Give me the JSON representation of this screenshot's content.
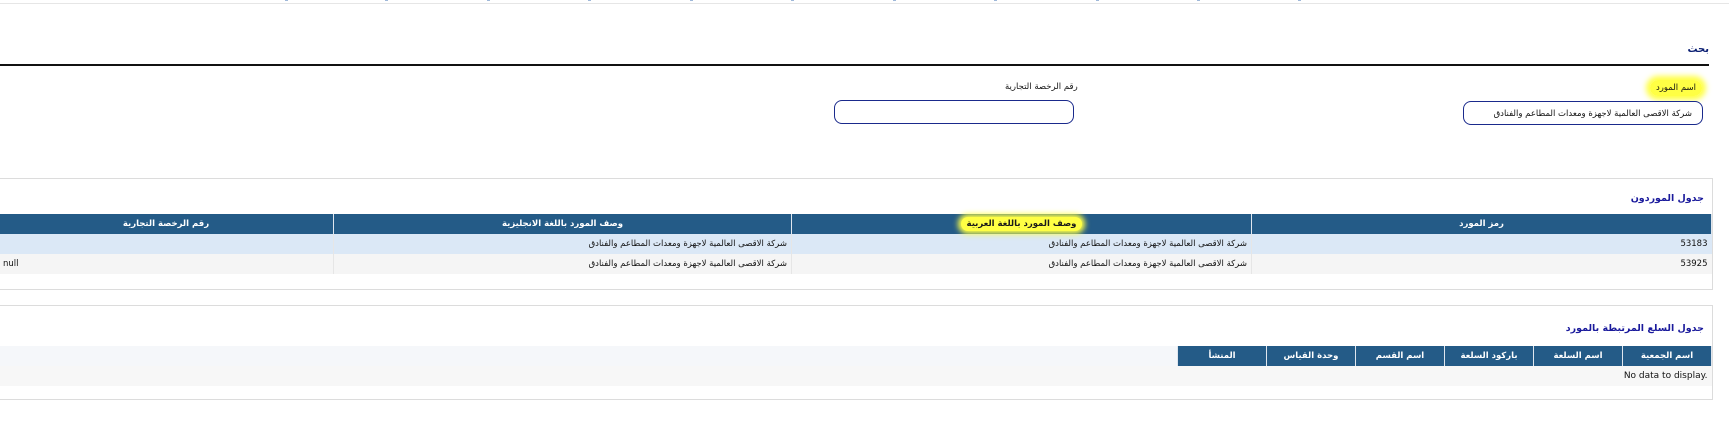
{
  "search": {
    "title": "بحث",
    "supplier_name_label": "اسم المورد",
    "supplier_name_value": "شركة الاقصى العالمية لاجهزة ومعدات المطاعم والفنادق",
    "license_label": "رقم الرخصة التجارية",
    "license_value": ""
  },
  "suppliers_table": {
    "title": "جدول الموردون",
    "columns": [
      "رمز المورد",
      "وصف المورد باللغة العربية",
      "وصف المورد باللغة الانجليزية",
      "رقم الرخصة التجارية"
    ],
    "rows": [
      {
        "code": "53183",
        "desc_ar": "شركة الاقصى العالمية لاجهزة ومعدات المطاعم والفنادق",
        "desc_en": "شركة الاقصى العالمية لاجهزة ومعدات المطاعم والفنادق",
        "license": ""
      },
      {
        "code": "53925",
        "desc_ar": "شركة الاقصى العالمية لاجهزة ومعدات المطاعم والفنادق",
        "desc_en": "شركة الاقصى العالمية لاجهزة ومعدات المطاعم والفنادق",
        "license": "null"
      }
    ]
  },
  "items_table": {
    "title": "جدول السلع المرتبطة بالمورد",
    "columns": [
      "اسم الجمعية",
      "اسم السلعة",
      "باركود السلعة",
      "اسم القسم",
      "وحدة القياس",
      "المنشأ"
    ],
    "empty_text": "No data to display."
  },
  "colors": {
    "header_bg": "#245b87",
    "highlight": "#ffff44",
    "input_border": "#1a2a8c"
  }
}
